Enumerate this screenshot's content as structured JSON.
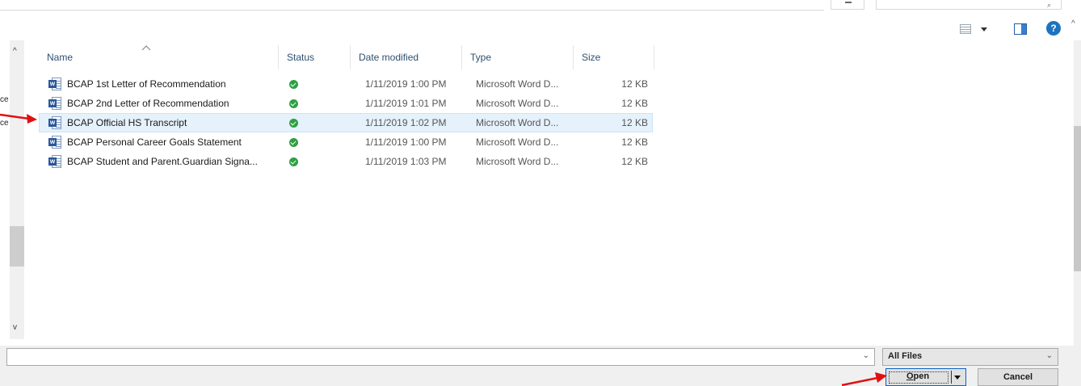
{
  "columns": {
    "name": "Name",
    "status": "Status",
    "date_modified": "Date modified",
    "type": "Type",
    "size": "Size"
  },
  "files": [
    {
      "name": "BCAP 1st Letter of Recommendation",
      "status_icon": "synced-check-icon",
      "date": "1/11/2019 1:00 PM",
      "type": "Microsoft Word D...",
      "size": "12 KB",
      "selected": false
    },
    {
      "name": "BCAP 2nd Letter of Recommendation",
      "status_icon": "synced-check-icon",
      "date": "1/11/2019 1:01 PM",
      "type": "Microsoft Word D...",
      "size": "12 KB",
      "selected": false
    },
    {
      "name": "BCAP Official HS Transcript",
      "status_icon": "synced-check-icon",
      "date": "1/11/2019 1:02 PM",
      "type": "Microsoft Word D...",
      "size": "12 KB",
      "selected": true
    },
    {
      "name": "BCAP Personal Career Goals Statement",
      "status_icon": "synced-check-icon",
      "date": "1/11/2019 1:00 PM",
      "type": "Microsoft Word D...",
      "size": "12 KB",
      "selected": false
    },
    {
      "name": "BCAP Student and Parent.Guardian Signa...",
      "status_icon": "synced-check-icon",
      "date": "1/11/2019 1:03 PM",
      "type": "Microsoft Word D...",
      "size": "12 KB",
      "selected": false
    }
  ],
  "nav_fragments": [
    "ce",
    "ce",
    "ce"
  ],
  "bottom": {
    "filename_value": "",
    "filetype_value": "All Files",
    "open_label_u": "O",
    "open_label_rest": "pen",
    "cancel_label": "Cancel"
  },
  "colors": {
    "selection": "#e5f1fb",
    "status_ok": "#2ea043",
    "word_blue": "#2b579a",
    "annotation_red": "#e01010",
    "help_blue": "#1e73be"
  },
  "icons": {
    "file": "word-document-icon",
    "view": "view-options-icon",
    "pane": "preview-pane-icon",
    "help": "help-icon"
  }
}
